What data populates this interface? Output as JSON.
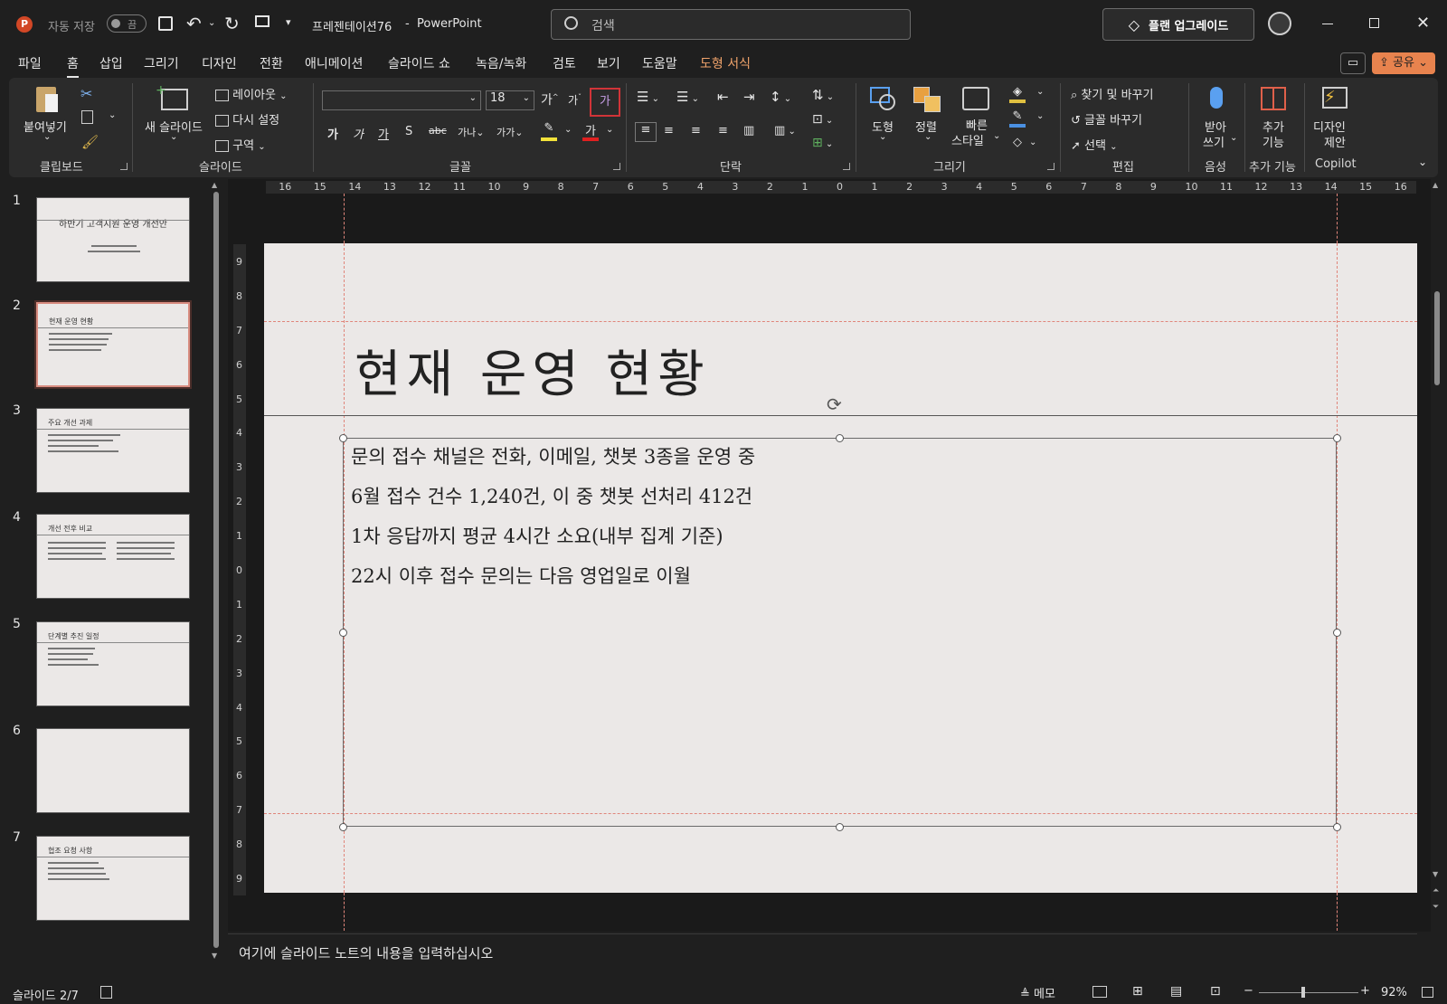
{
  "titlebar": {
    "autosave_label": "자동 저장",
    "autosave_state": "끔",
    "document_name": "프레젠테이션76",
    "separator": "-",
    "app_name": "PowerPoint",
    "search_placeholder": "검색",
    "upgrade_label": "플랜 업그레이드"
  },
  "menu": {
    "tabs": [
      "파일",
      "홈",
      "삽입",
      "그리기",
      "디자인",
      "전환",
      "애니메이션",
      "슬라이드 쇼",
      "녹음/녹화",
      "검토",
      "보기",
      "도움말",
      "도형 서식"
    ],
    "active_tab": "홈",
    "share_label": "공유"
  },
  "ribbon": {
    "clipboard": {
      "paste_label": "붙여넣기",
      "group_label": "클립보드"
    },
    "slides": {
      "new_slide_label": "새 슬라이드",
      "layout_label": "레이아웃",
      "reset_label": "다시 설정",
      "section_label": "구역",
      "group_label": "슬라이드"
    },
    "font": {
      "font_name_value": "",
      "font_size_value": "18",
      "group_label": "글꼴"
    },
    "paragraph": {
      "group_label": "단락"
    },
    "drawing": {
      "shapes_label": "도형",
      "arrange_label": "정렬",
      "quick_styles_label_1": "빠른",
      "quick_styles_label_2": "스타일",
      "group_label": "그리기"
    },
    "editing": {
      "find_replace_label": "찾기 및 바꾸기",
      "replace_font_label": "글꼴 바꾸기",
      "select_label": "선택",
      "group_label": "편집"
    },
    "voice": {
      "dictate_label_1": "받아",
      "dictate_label_2": "쓰기",
      "group_label": "음성"
    },
    "addins": {
      "label_1": "추가",
      "label_2": "기능",
      "group_label": "추가 기능"
    },
    "copilot": {
      "label_1": "디자인",
      "label_2": "제안",
      "group_label": "Copilot"
    }
  },
  "slide_panel": {
    "slides": [
      {
        "number": "1",
        "title": "하반기 고객지원 운영 개선안"
      },
      {
        "number": "2",
        "title": "현재 운영 현황"
      },
      {
        "number": "3",
        "title": "주요 개선 과제"
      },
      {
        "number": "4",
        "title": "개선 전후 비교"
      },
      {
        "number": "5",
        "title": "단계별 추진 일정"
      },
      {
        "number": "6",
        "title": ""
      },
      {
        "number": "7",
        "title": "협조 요청 사항"
      }
    ],
    "selected": "2"
  },
  "ruler": {
    "top_ticks": [
      "16",
      "15",
      "14",
      "13",
      "12",
      "11",
      "10",
      "9",
      "8",
      "7",
      "6",
      "5",
      "4",
      "3",
      "2",
      "1",
      "0",
      "1",
      "2",
      "3",
      "4",
      "5",
      "6",
      "7",
      "8",
      "9",
      "10",
      "11",
      "12",
      "13",
      "14",
      "15",
      "16"
    ],
    "left_ticks": [
      "9",
      "8",
      "7",
      "6",
      "5",
      "4",
      "3",
      "2",
      "1",
      "0",
      "1",
      "2",
      "3",
      "4",
      "5",
      "6",
      "7",
      "8",
      "9"
    ]
  },
  "slide": {
    "title": "현재 운영 현황",
    "bullets": [
      "문의 접수 채널은 전화, 이메일, 챗봇 3종을 운영 중",
      "6월 접수 건수 1,240건, 이 중 챗봇 선처리 412건",
      "1차 응답까지 평균 4시간 소요(내부 집계 기준)",
      "22시 이후 접수 문의는 다음 영업일로 이월"
    ]
  },
  "notes": {
    "placeholder": "여기에 슬라이드 노트의 내용을 입력하십시오"
  },
  "status": {
    "slide_counter": "슬라이드 2/7",
    "notes_label": "메모",
    "zoom": "92%"
  }
}
